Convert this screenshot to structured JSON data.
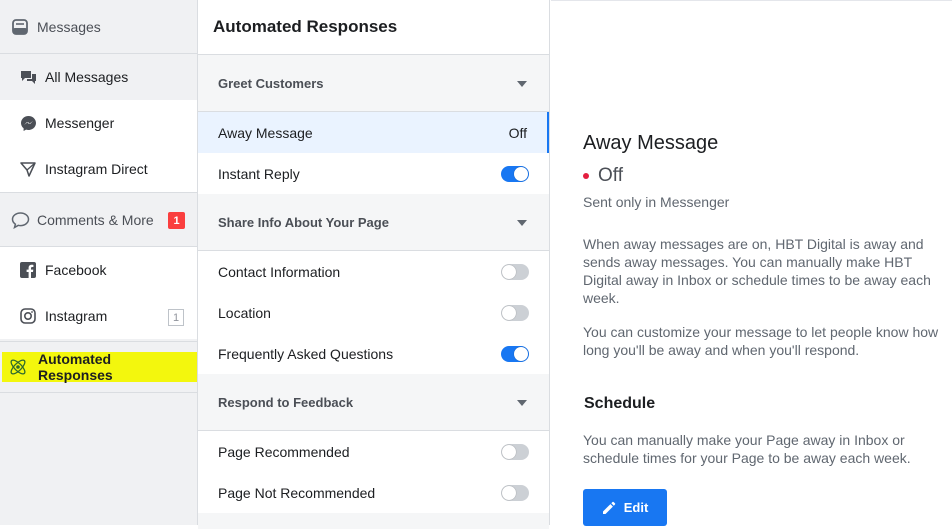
{
  "nav": {
    "messages_label": "Messages",
    "items_top": [
      {
        "label": "All Messages",
        "icon": "chat-bubbles-icon"
      },
      {
        "label": "Messenger",
        "icon": "messenger-icon"
      },
      {
        "label": "Instagram Direct",
        "icon": "paper-plane-icon"
      }
    ],
    "comments_label": "Comments & More",
    "comments_badge": "1",
    "items_bottom": [
      {
        "label": "Facebook",
        "icon": "facebook-icon"
      },
      {
        "label": "Instagram",
        "icon": "instagram-icon",
        "badge": "1"
      }
    ],
    "automated_label": "Automated Responses"
  },
  "middle": {
    "title": "Automated Responses",
    "sections": [
      {
        "heading": "Greet Customers",
        "rows": [
          {
            "label": "Away Message",
            "value": "Off"
          },
          {
            "label": "Instant Reply",
            "toggle": "on"
          }
        ]
      },
      {
        "heading": "Share Info About Your Page",
        "rows": [
          {
            "label": "Contact Information",
            "toggle": "off"
          },
          {
            "label": "Location",
            "toggle": "off"
          },
          {
            "label": "Frequently Asked Questions",
            "toggle": "on"
          }
        ]
      },
      {
        "heading": "Respond to Feedback",
        "rows": [
          {
            "label": "Page Recommended",
            "toggle": "off"
          },
          {
            "label": "Page Not Recommended",
            "toggle": "off"
          }
        ]
      }
    ]
  },
  "detail": {
    "title": "Away Message",
    "status": "Off",
    "sent_note": "Sent only in Messenger",
    "para1": "When away messages are on, HBT Digital is away and sends away messages. You can manually make HBT Digital away in Inbox or schedule times to be away each week.",
    "para2": "You can customize your message to let people know how long you'll be away and when you'll respond.",
    "schedule_heading": "Schedule",
    "schedule_text": "You can manually make your Page away in Inbox or schedule times for your Page to be away each week.",
    "edit_label": "Edit"
  },
  "colors": {
    "accent": "#1877f2",
    "highlight": "#f3f70d",
    "badge": "#fa3e3e",
    "status_dot": "#e41e3f"
  }
}
